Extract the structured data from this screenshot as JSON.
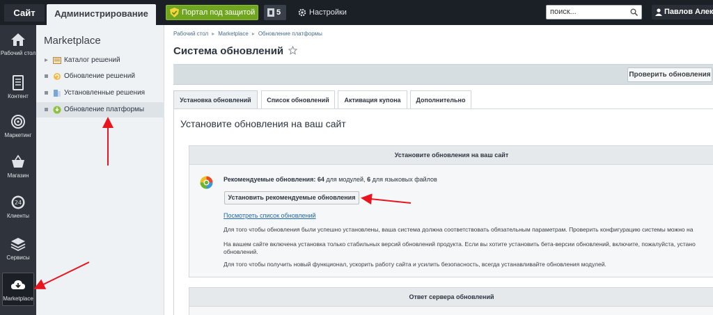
{
  "topbar": {
    "tab_site": "Сайт",
    "tab_admin": "Администрирование",
    "portal_button": "Портал под защитой",
    "notifications_count": "5",
    "settings_label": "Настройки",
    "search_placeholder": "поиск...",
    "user_name": "Павлов Александр"
  },
  "rail": {
    "items": [
      {
        "label": "Рабочий стол",
        "icon": "home-icon"
      },
      {
        "label": "Контент",
        "icon": "document-icon"
      },
      {
        "label": "Маркетинг",
        "icon": "target-icon"
      },
      {
        "label": "Магазин",
        "icon": "basket-icon"
      },
      {
        "label": "Клиенты",
        "icon": "clock-24-icon"
      },
      {
        "label": "Сервисы",
        "icon": "layers-icon"
      },
      {
        "label": "Marketplace",
        "icon": "cloud-download-icon"
      }
    ]
  },
  "menu": {
    "title": "Marketplace",
    "items": [
      {
        "label": "Каталог решений"
      },
      {
        "label": "Обновление решений"
      },
      {
        "label": "Установленные решения"
      },
      {
        "label": "Обновление платформы"
      }
    ]
  },
  "breadcrumb": [
    "Рабочий стол",
    "Marketplace",
    "Обновление платформы"
  ],
  "page": {
    "title": "Система обновлений",
    "check_button": "Проверить обновления",
    "tabs": [
      "Установка обновлений",
      "Список обновлений",
      "Активация купона",
      "Дополнительно"
    ],
    "content_title": "Установите обновления на ваш сайт"
  },
  "box": {
    "header": "Установите обновления на ваш сайт",
    "recommend_bold": "Рекомендуемые обновления: 64",
    "recommend_mid": " для модулей, ",
    "recommend_bold2": "6",
    "recommend_tail": " для языковых файлов",
    "install_button": "Установить рекомендуемые обновления",
    "view_list_link": "Посмотреть список обновлений",
    "para1": "Для того чтобы обновления были успешно установлены, ваша система должна соответствовать обязательным параметрам. Проверить конфигурацию системы можно на",
    "para2_line1": "На вашем сайте включена установка только стабильных версий обновлений продукта. Если вы хотите установить бета-версии обновлений, включите, пожалуйста, устано",
    "para2_line2": "обновлений.",
    "para3": "Для того чтобы получить новый функционал, ускорить работу сайта и усилить безопасность, всегда устанавливайте обновления модулей."
  },
  "box2": {
    "header": "Ответ сервера обновлений"
  },
  "colors": {
    "accent_green": "#70a520",
    "annotation_red": "#e8141e",
    "link_blue": "#2067b0"
  }
}
